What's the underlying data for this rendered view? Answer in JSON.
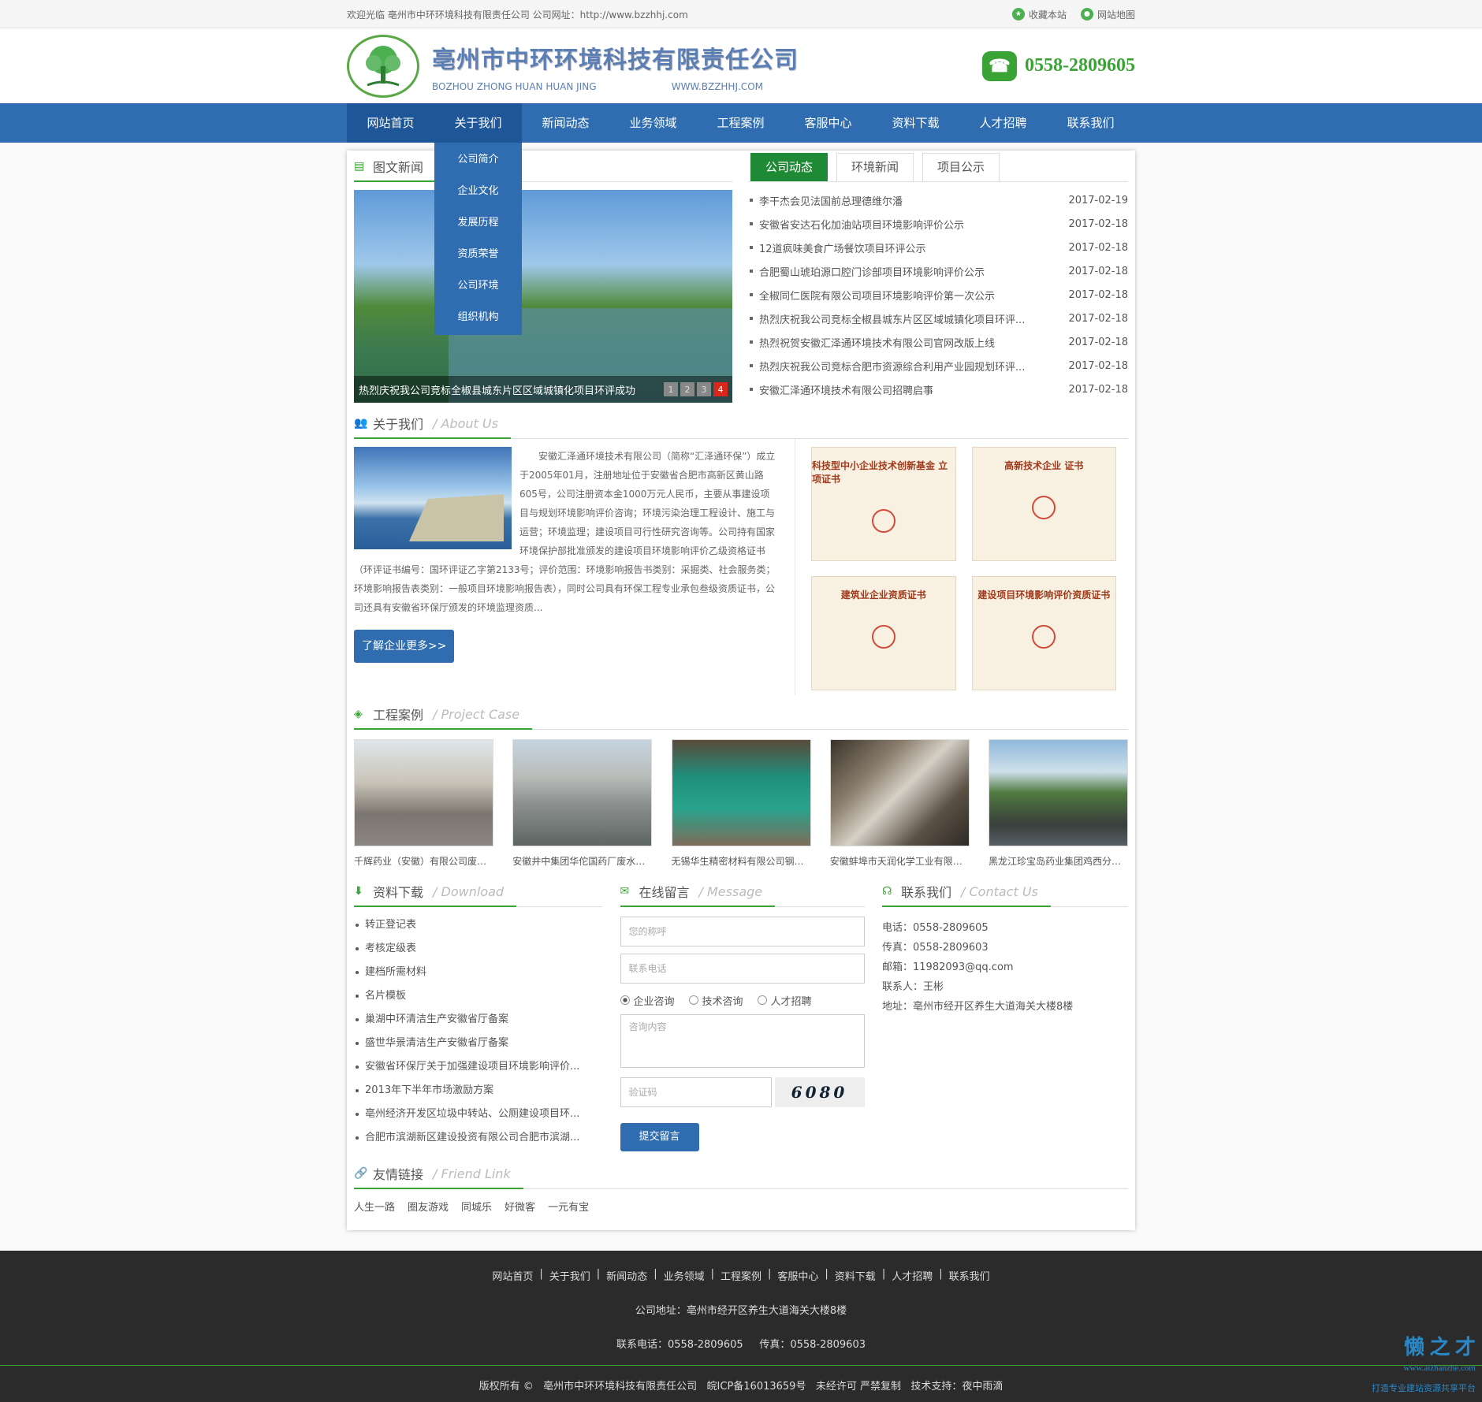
{
  "topbar": {
    "welcome": "欢迎光临 亳州市中环环境科技有限责任公司 公司网址：http://www.bzzhhj.com",
    "favorite": "收藏本站",
    "sitemap": "网站地图"
  },
  "header": {
    "company": "亳州市中环环境科技有限责任公司",
    "pinyin": "BOZHOU ZHONG HUAN HUAN JING",
    "domain": "WWW.BZZHHJ.COM",
    "phone": "0558-2809605"
  },
  "nav": [
    "网站首页",
    "关于我们",
    "新闻动态",
    "业务领域",
    "工程案例",
    "客服中心",
    "资料下载",
    "人才招聘",
    "联系我们"
  ],
  "dropdown": [
    "公司简介",
    "企业文化",
    "发展历程",
    "资质荣誉",
    "公司环境",
    "组织机构"
  ],
  "photo_news": {
    "title": "图文新闻",
    "caption": "热烈庆祝我公司竞标全椒县城东片区区域城镇化项目环评成功",
    "pages": [
      "1",
      "2",
      "3",
      "4"
    ],
    "active_page": "4"
  },
  "news_tabs": [
    "公司动态",
    "环境新闻",
    "项目公示"
  ],
  "news": [
    {
      "title": "李干杰会见法国前总理德维尔潘",
      "date": "2017-02-19"
    },
    {
      "title": "安徽省安达石化加油站项目环境影响评价公示",
      "date": "2017-02-18"
    },
    {
      "title": "12道疯味美食广场餐饮项目环评公示",
      "date": "2017-02-18"
    },
    {
      "title": "合肥蜀山琥珀源口腔门诊部项目环境影响评价公示",
      "date": "2017-02-18"
    },
    {
      "title": "全椒同仁医院有限公司项目环境影响评价第一次公示",
      "date": "2017-02-18"
    },
    {
      "title": "热烈庆祝我公司竞标全椒县城东片区区域城镇化项目环评...",
      "date": "2017-02-18"
    },
    {
      "title": "热烈祝贺安徽汇泽通环境技术有限公司官网改版上线",
      "date": "2017-02-18"
    },
    {
      "title": "热烈庆祝我公司竞标合肥市资源综合利用产业园规划环评...",
      "date": "2017-02-18"
    },
    {
      "title": "安徽汇泽通环境技术有限公司招聘启事",
      "date": "2017-02-18"
    }
  ],
  "about": {
    "title": "关于我们",
    "en": "/ About Us",
    "text": "安徽汇泽通环境技术有限公司（简称“汇泽通环保”）成立于2005年01月，注册地址位于安徽省合肥市高新区黄山路605号，公司注册资本金1000万元人民币，主要从事建设项目与规划环境影响评价咨询；环境污染治理工程设计、施工与运营；环境监理；建设项目可行性研究咨询等。公司持有国家环境保护部批准颁发的建设项目环境影响评价乙级资格证书（环评证书编号：国环评证乙字第2133号；评价范围：环境影响报告书类别：采掘类、社会服务类；环境影响报告表类别：一般项目环境影响报告表），同时公司具有环保工程专业承包叁级资质证书，公司还具有安徽省环保厅颁发的环境监理资质...",
    "more": "了解企业更多>>",
    "certs": [
      "科技型中小企业技术创新基金 立项证书",
      "高新技术企业 证书",
      "建筑业企业资质证书",
      "建设项目环境影响评价资质证书"
    ]
  },
  "cases": {
    "title": "工程案例",
    "en": "/ Project Case",
    "items": [
      "千辉药业（安徽）有限公司废水...",
      "安徽井中集团华佗国药厂废水处...",
      "无锡华生精密材料有限公司钢带...",
      "安徽蚌埠市天润化学工业有限公...",
      "黑龙江珍宝岛药业集团鸡西分公..."
    ]
  },
  "downloads": {
    "title": "资料下载",
    "en": "/ Download",
    "items": [
      "转正登记表",
      "考核定级表",
      "建档所需材料",
      "名片模板",
      "巢湖中环清洁生产安徽省厅备案",
      "盛世华景清洁生产安徽省厅备案",
      "安徽省环保厅关于加强建设项目环境影响评价...",
      "2013年下半年市场激励方案",
      "亳州经济开发区垃圾中转站、公厕建设项目环...",
      "合肥市滨湖新区建设投资有限公司合肥市滨湖..."
    ]
  },
  "message": {
    "title": "在线留言",
    "en": "/ Message",
    "name_ph": "您的称呼",
    "phone_ph": "联系电话",
    "radios": [
      "企业咨询",
      "技术咨询",
      "人才招聘"
    ],
    "content_ph": "咨询内容",
    "code_ph": "验证码",
    "captcha": "6080",
    "submit": "提交留言"
  },
  "contact": {
    "title": "联系我们",
    "en": "/ Contact Us",
    "tel": "电话：0558-2809605",
    "fax": "传真：0558-2809603",
    "email": "邮箱：11982093@qq.com",
    "person": "联系人：王彬",
    "address": "地址：亳州市经开区养生大道海关大楼8楼"
  },
  "links": {
    "title": "友情链接",
    "en": "/ Friend Link",
    "items": [
      "人生一路",
      "圈友游戏",
      "同城乐",
      "好微客",
      "一元有宝"
    ]
  },
  "footer": {
    "nav": [
      "网站首页",
      "关于我们",
      "新闻动态",
      "业务领域",
      "工程案例",
      "客服中心",
      "资料下载",
      "人才招聘",
      "联系我们"
    ],
    "address": "公司地址：亳州市经开区养生大道海关大楼8楼",
    "phones": "联系电话：0558-2809605     传真：0558-2809603",
    "copyright": "版权所有 ©   亳州市中环环境科技有限责任公司   皖ICP备16013659号   未经许可 严禁复制   技术支持：夜中雨滴"
  },
  "watermark": {
    "title": "懒 之 才",
    "url": "www.aizhanzhe.com",
    "slogan": "打造专业建站资源共享平台"
  },
  "colors": {
    "nav": "#2f6db0",
    "green": "#3aa335",
    "footer": "#2b2b2b"
  }
}
